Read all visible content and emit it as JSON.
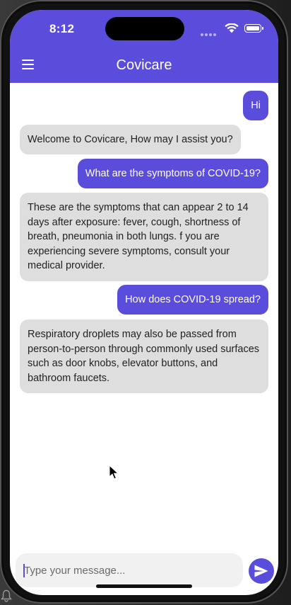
{
  "status_bar": {
    "time": "8:12"
  },
  "app_bar": {
    "title": "Covicare",
    "menu_icon": "hamburger-menu-icon"
  },
  "messages": [
    {
      "sender": "user",
      "text": "Hi"
    },
    {
      "sender": "bot",
      "text": "Welcome to Covicare, How may I assist you?"
    },
    {
      "sender": "user",
      "text": "What are the symptoms of COVID-19?"
    },
    {
      "sender": "bot",
      "text": "These are the symptoms that can appear 2 to 14 days after exposure: fever, cough, shortness of breath, pneumonia in both lungs. f you are experiencing severe symptoms, consult your medical provider."
    },
    {
      "sender": "user",
      "text": "How does COVID-19 spread?"
    },
    {
      "sender": "bot",
      "text": "Respiratory droplets may also be passed from person-to-person through commonly used surfaces such as door knobs, elevator buttons, and bathroom faucets."
    }
  ],
  "composer": {
    "placeholder": "Type your message...",
    "value": "",
    "send_icon": "send-icon"
  },
  "colors": {
    "accent": "#5b4ddb",
    "bot_bubble": "#dedede",
    "background": "#ffffff"
  }
}
